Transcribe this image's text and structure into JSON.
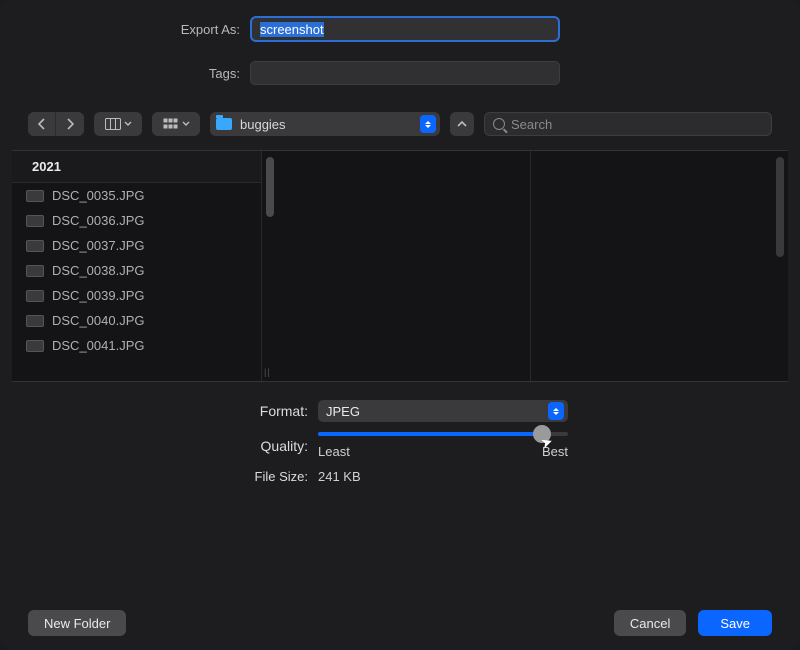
{
  "header": {
    "export_as_label": "Export As:",
    "filename": "screenshot",
    "tags_label": "Tags:"
  },
  "toolbar": {
    "folder_name": "buggies",
    "search_placeholder": "Search"
  },
  "browser": {
    "column_header": "2021",
    "files": [
      "DSC_0035.JPG",
      "DSC_0036.JPG",
      "DSC_0037.JPG",
      "DSC_0038.JPG",
      "DSC_0039.JPG",
      "DSC_0040.JPG",
      "DSC_0041.JPG"
    ]
  },
  "options": {
    "format_label": "Format:",
    "format_value": "JPEG",
    "quality_label": "Quality:",
    "quality_min_label": "Least",
    "quality_max_label": "Best",
    "quality_percent": 88,
    "filesize_label": "File Size:",
    "filesize_value": "241 KB"
  },
  "footer": {
    "new_folder": "New Folder",
    "cancel": "Cancel",
    "save": "Save"
  }
}
